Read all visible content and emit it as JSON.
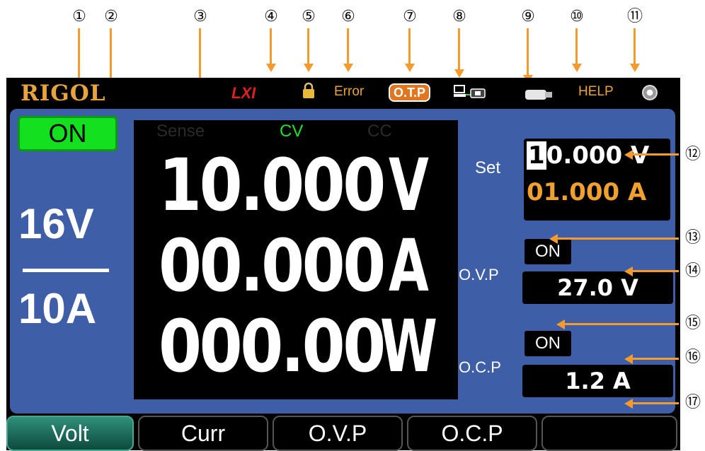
{
  "callouts": [
    "①",
    "②",
    "③",
    "④",
    "⑤",
    "⑥",
    "⑦",
    "⑧",
    "⑨",
    "⑩",
    "⑪",
    "⑫",
    "⑬",
    "⑭",
    "⑮",
    "⑯",
    "⑰"
  ],
  "status_bar": {
    "brand": "RIGOL",
    "lxi": "LXI",
    "lock_icon": "lock-icon",
    "error": "Error",
    "otp": "O.T.P",
    "network_icon": "network-icon",
    "usb_icon": "usb-icon",
    "help": "HELP",
    "beeper_icon": "beeper-icon"
  },
  "output": {
    "state": "ON",
    "range_voltage": "16V",
    "range_current": "10A"
  },
  "display": {
    "modes": {
      "sense": "Sense",
      "cv": "CV",
      "cc": "CC"
    },
    "voltage": "10.000",
    "voltage_unit": "V",
    "current": "00.000",
    "current_unit": "A",
    "power": "000.00",
    "power_unit": "W"
  },
  "settings": {
    "label": "Set",
    "voltage_cursor_digit": "1",
    "voltage_rest": "0.000 V",
    "current": "01.000 A"
  },
  "protection": {
    "ovp_state": "ON",
    "ovp_label": "O.V.P",
    "ovp_value": "27.0 V",
    "ocp_state": "ON",
    "ocp_label": "O.C.P",
    "ocp_value": "1.2 A"
  },
  "softkeys": [
    "Volt",
    "Curr",
    "O.V.P",
    "O.C.P",
    ""
  ],
  "colors": {
    "panel_blue": "#3e5ea8",
    "brand_orange": "#e8a33a",
    "cv_green": "#19e325",
    "on_green": "#13e01e",
    "callout_orange": "#f59a2c"
  }
}
